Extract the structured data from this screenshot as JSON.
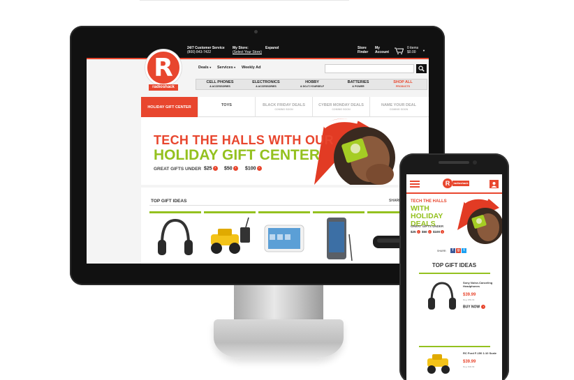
{
  "desktop": {
    "topbar": {
      "customer_service_label": "24/7 Customer Service",
      "customer_service_phone": "(800) 843-7422",
      "my_store_label": "My Store:",
      "my_store_link": "(Select Your Store)",
      "language": "Espanol",
      "store_finder_line1": "Store",
      "store_finder_line2": "Finder",
      "my_account_line1": "My",
      "my_account_line2": "Account",
      "cart_items": "0 items",
      "cart_total": "$0.00"
    },
    "logo": {
      "letter": "R",
      "word": "radioshack"
    },
    "nav": {
      "deals": "Deals",
      "services": "Services",
      "weekly_ad": "Weekly Ad"
    },
    "search": {
      "placeholder": "",
      "button_icon": "search-icon"
    },
    "categories": [
      {
        "label": "CELL PHONES",
        "sub": "& ACCESSORIES"
      },
      {
        "label": "ELECTRONICS",
        "sub": "& ACCESSORIES"
      },
      {
        "label": "HOBBY",
        "sub": "& DO-IT-YOURSELF"
      },
      {
        "label": "BATTERIES",
        "sub": "& POWER"
      },
      {
        "label": "SHOP ALL",
        "sub": "PRODUCTS"
      }
    ],
    "tabs": [
      {
        "label": "HOLIDAY GIFT CENTER",
        "sub": ""
      },
      {
        "label": "TOYS",
        "sub": ""
      },
      {
        "label": "BLACK FRIDAY DEALS",
        "sub": "COMING SOON"
      },
      {
        "label": "CYBER MONDAY DEALS",
        "sub": "COMING SOON"
      },
      {
        "label": "NAME YOUR DEAL",
        "sub": "COMING SOON"
      }
    ],
    "hero": {
      "line1": "TECH THE HALLS WITH OUR",
      "line2": "HOLIDAY GIFT CENTER",
      "line3": "GREAT GIFTS UNDER",
      "prices": [
        "$25",
        "$50",
        "$100"
      ]
    },
    "gifts": {
      "title": "TOP GIFT IDEAS",
      "share": "SHARE:"
    }
  },
  "phone": {
    "logo_letter": "R",
    "logo_word": "radioshack",
    "hero": {
      "line1": "TECH THE HALLS",
      "line2": "WITH HOLIDAY DEALS",
      "line3": "GREAT GIFTS UNDER",
      "prices": [
        "$25",
        "$50",
        "$100"
      ]
    },
    "share": "SHARE:",
    "gifts_title": "TOP GIFT IDEAS",
    "items": [
      {
        "name": "Sony Noise-Canceling Headphones",
        "price": "$39.99",
        "reg": "Reg. $59.99",
        "buy": "BUY NOW"
      },
      {
        "name": "RC Ford F-150 1:10 Scale",
        "price": "$39.99",
        "reg": "Reg. $49.99"
      }
    ]
  },
  "colors": {
    "brand_red": "#e8462e",
    "accent_green": "#94c11f",
    "facebook": "#3b5998"
  }
}
